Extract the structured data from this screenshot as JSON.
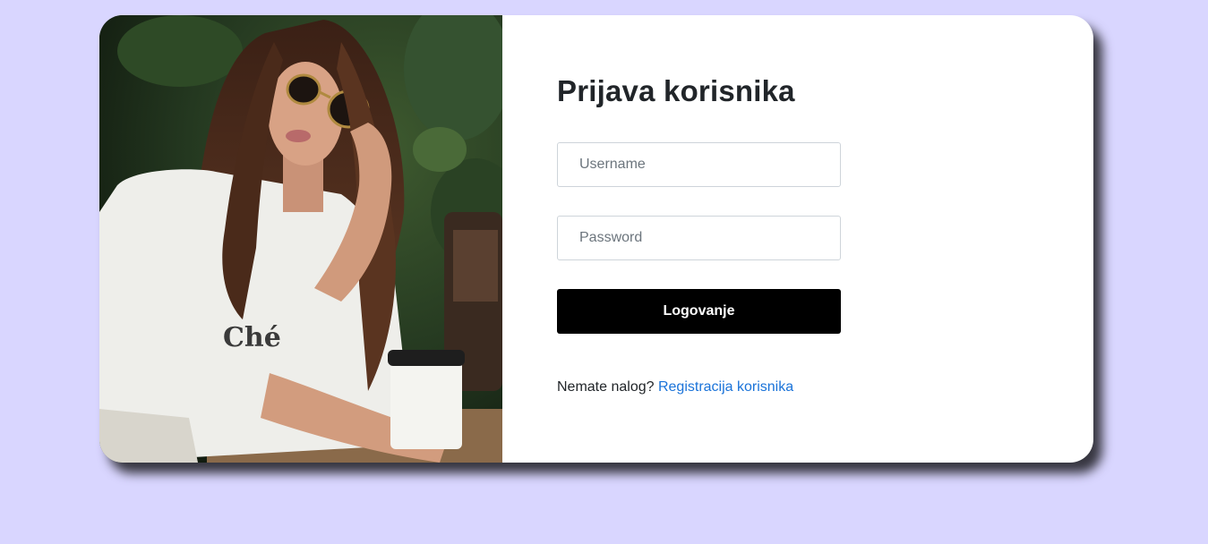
{
  "login": {
    "title": "Prijava korisnika",
    "username_placeholder": "Username",
    "password_placeholder": "Password",
    "submit_label": "Logovanje",
    "signup_prompt": "Nemate nalog?",
    "signup_link": "Registracija korisnika"
  },
  "photo": {
    "shirt_text": "Ché"
  },
  "colors": {
    "page_background": "#d9d6ff",
    "card_background": "#ffffff",
    "button_background": "#000000",
    "link": "#1a73d9"
  }
}
